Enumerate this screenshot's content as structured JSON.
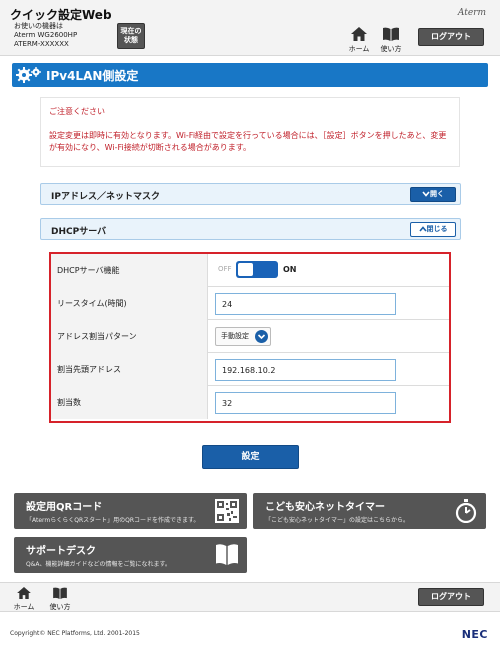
{
  "header": {
    "app_title": "クイック設定Web",
    "device_label": "お使いの機器は",
    "device_model": "Aterm WG2600HP",
    "device_id": "ATERM-XXXXXX",
    "status_button_line1": "現在の",
    "status_button_line2": "状態",
    "brand": "Aterm",
    "home_label": "ホーム",
    "help_label": "使い方",
    "logout_label": "ログアウト"
  },
  "page": {
    "title": "IPv4LAN側設定"
  },
  "notice": {
    "heading": "ご注意ください",
    "body": "設定変更は即時に有効となります。Wi-Fi経由で設定を行っている場合には、［設定］ボタンを押したあと、変更が有効になり、Wi-Fi接続が切断される場合があります。"
  },
  "sections": {
    "ip_mask": {
      "label": "IPアドレス／ネットマスク",
      "button": "開く"
    },
    "dhcp": {
      "label": "DHCPサーバ",
      "button": "閉じる"
    }
  },
  "dhcp_settings": {
    "server_function": {
      "label": "DHCPサーバ機能",
      "off_label": "OFF",
      "on_label": "ON",
      "enabled": true
    },
    "lease_time": {
      "label": "リースタイム(時間)",
      "value": "24"
    },
    "assignment_pattern": {
      "label": "アドレス割当パターン",
      "value": "手動設定"
    },
    "start_address": {
      "label": "割当先頭アドレス",
      "value": "192.168.10.2"
    },
    "count": {
      "label": "割当数",
      "value": "32"
    }
  },
  "actions": {
    "submit_label": "設定"
  },
  "cards": {
    "qr": {
      "title": "設定用QRコード",
      "desc": "「AtermらくらくQRスタート」用のQRコードを作成できます。"
    },
    "timer": {
      "title": "こども安心ネットタイマー",
      "desc": "「こども安心ネットタイマー」の設定はこちらから。"
    },
    "support": {
      "title": "サポートデスク",
      "desc": "Q&A、機能詳細ガイドなどの情報をご覧になれます。"
    }
  },
  "footer": {
    "home_label": "ホーム",
    "help_label": "使い方",
    "logout_label": "ログアウト",
    "copyright": "Copyright© NEC Platforms, Ltd. 2001-2015",
    "logo": "NEC"
  },
  "colors": {
    "primary": "#1a5fa8",
    "title_bar": "#1877c6",
    "highlight": "#d6222a",
    "dark_button": "#555555"
  }
}
